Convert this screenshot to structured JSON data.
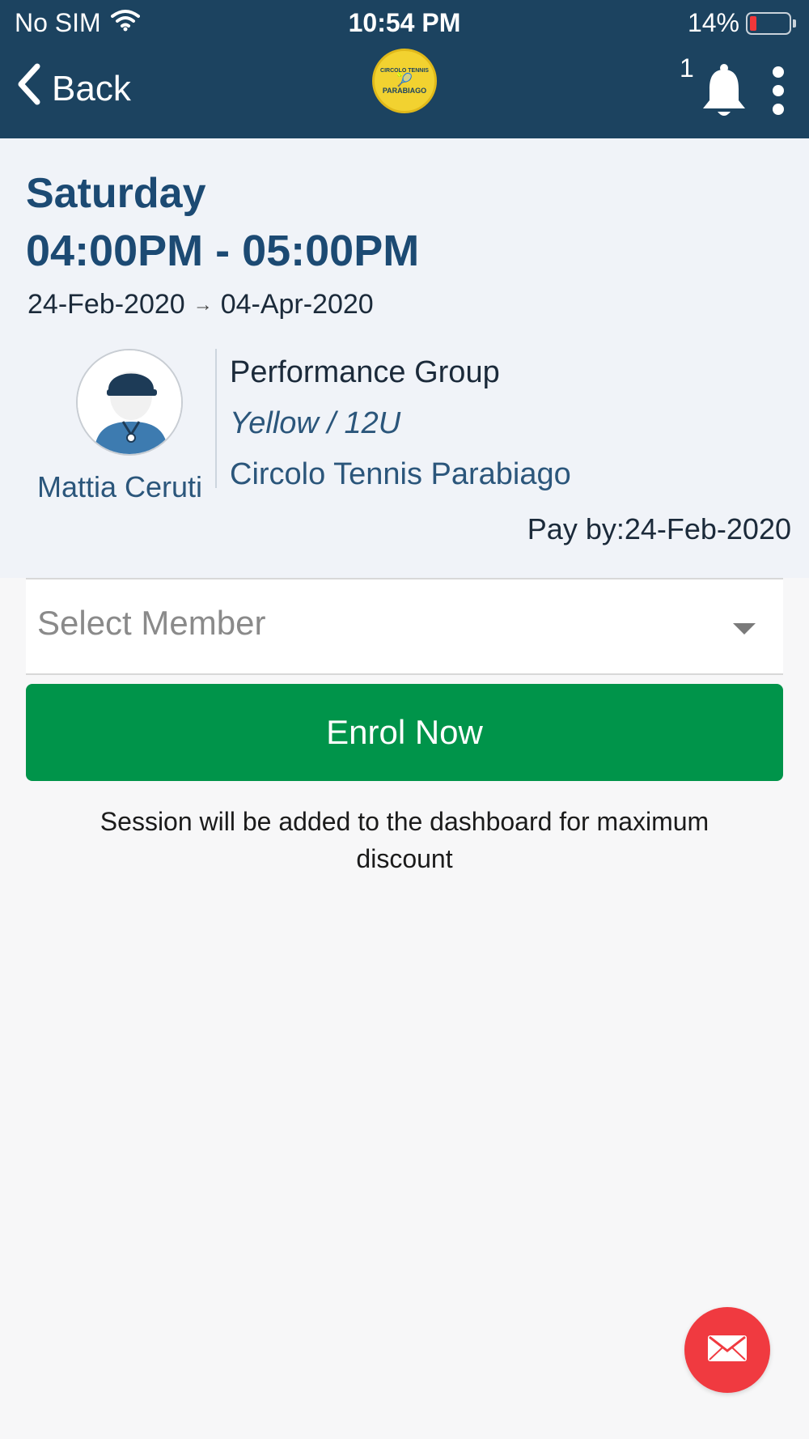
{
  "status_bar": {
    "carrier": "No SIM",
    "time": "10:54 PM",
    "battery": "14%"
  },
  "nav": {
    "back_label": "Back",
    "logo_text_top": "CIRCOLO TENNIS",
    "logo_text_bottom": "PARABIAGO",
    "notification_count": "1"
  },
  "session": {
    "day": "Saturday",
    "time_range": "04:00PM - 05:00PM",
    "start_date": "24-Feb-2020",
    "end_date": "04-Apr-2020",
    "coach_name": "Mattia Ceruti",
    "group": "Performance Group",
    "level": "Yellow / 12U",
    "venue": "Circolo Tennis Parabiago",
    "pay_by": "Pay by:24-Feb-2020"
  },
  "form": {
    "select_placeholder": "Select Member",
    "enrol_label": "Enrol Now",
    "note": "Session will be added to the dashboard for maximum discount"
  },
  "colors": {
    "header": "#1c4360",
    "accent_text": "#1c4a73",
    "enrol_button": "#00944a",
    "fab": "#f03a40",
    "battery_low": "#f0373a"
  },
  "icons": [
    "wifi-icon",
    "battery-icon",
    "back-chevron-icon",
    "bell-icon",
    "more-vertical-icon",
    "coach-avatar-icon",
    "chevron-down-icon",
    "mail-icon"
  ]
}
